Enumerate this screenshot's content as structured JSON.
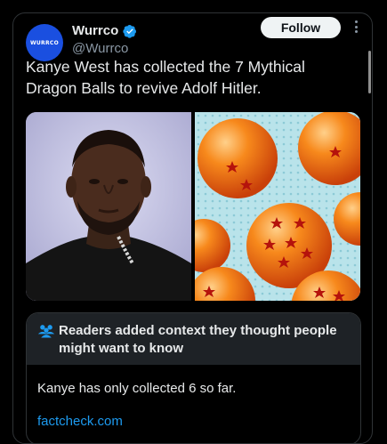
{
  "account": {
    "name": "Wurrco",
    "handle": "@Wurrco",
    "avatar_text": "WURRCO",
    "verified_icon": "verified-badge-icon",
    "verified_color": "#1d9bf0"
  },
  "actions": {
    "follow_label": "Follow",
    "more_icon": "more-vertical-icon"
  },
  "tweet": {
    "text": "Kanye West has collected the 7 Mythical Dragon Balls to revive Adolf Hitler."
  },
  "media": {
    "left_image": "kanye-photo",
    "right_image": "dragon-balls-photo"
  },
  "community_note": {
    "icon": "people-icon",
    "title": "Readers added context they thought people might want to know",
    "body": "Kanye has only collected 6 so far.",
    "link": "factcheck.com",
    "link_color": "#1d9bf0"
  }
}
